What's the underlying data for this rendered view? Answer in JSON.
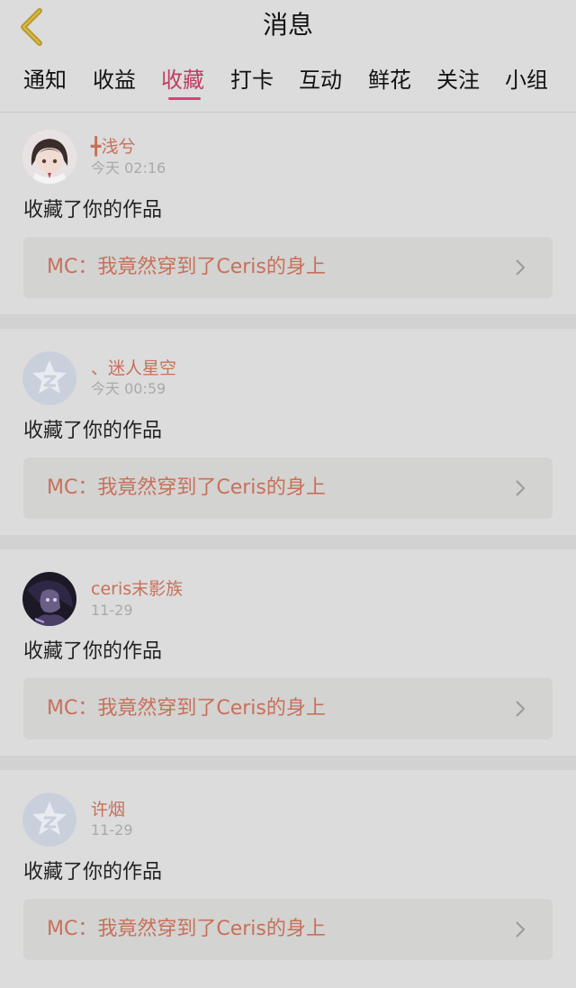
{
  "header": {
    "title": "消息"
  },
  "tabs": [
    {
      "label": "通知"
    },
    {
      "label": "收益"
    },
    {
      "label": "收藏"
    },
    {
      "label": "打卡"
    },
    {
      "label": "互动"
    },
    {
      "label": "鲜花"
    },
    {
      "label": "关注"
    },
    {
      "label": "小组"
    }
  ],
  "active_tab": "收藏",
  "colors": {
    "accent_tab": "#c23c63",
    "username": "#c7705a",
    "work_title": "#c7705a"
  },
  "notifications": [
    {
      "username": "╋浅兮",
      "time": "今天 02:16",
      "action": "收藏了你的作品",
      "work_title": "MC：我竟然穿到了Ceris的身上",
      "avatar_icon": "anime-girl-avatar-icon"
    },
    {
      "username": "、迷人星空",
      "time": "今天 00:59",
      "action": "收藏了你的作品",
      "work_title": "MC：我竟然穿到了Ceris的身上",
      "avatar_icon": "default-star-avatar-icon"
    },
    {
      "username": "ceris末影族",
      "time": "11-29",
      "action": "收藏了你的作品",
      "work_title": "MC：我竟然穿到了Ceris的身上",
      "avatar_icon": "dark-character-avatar-icon"
    },
    {
      "username": "许烟",
      "time": "11-29",
      "action": "收藏了你的作品",
      "work_title": "MC：我竟然穿到了Ceris的身上",
      "avatar_icon": "default-star-avatar-icon"
    }
  ]
}
